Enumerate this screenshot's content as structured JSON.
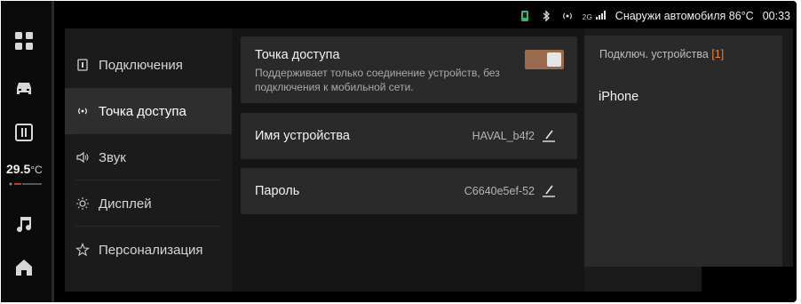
{
  "status_bar": {
    "network_label": "2G",
    "outside_temp_label": "Снаружи автомобиля 86°C",
    "time": "00:33",
    "icons": [
      "phone-connected-icon",
      "bluetooth-icon",
      "hotspot-icon",
      "signal-icon"
    ]
  },
  "left_rail": {
    "icons": [
      "apps-grid-icon",
      "car-icon",
      "settings-panel-icon",
      "music-note-icon",
      "home-icon"
    ],
    "temperature": "29.5",
    "temperature_unit": "°C"
  },
  "menu": {
    "items": [
      {
        "label": "Подключения",
        "icon": "connections-icon",
        "active": false
      },
      {
        "label": "Точка доступа",
        "icon": "hotspot-icon",
        "active": true
      },
      {
        "label": "Звук",
        "icon": "speaker-icon",
        "active": false
      },
      {
        "label": "Дисплей",
        "icon": "brightness-icon",
        "active": false
      },
      {
        "label": "Персонализация",
        "icon": "personalization-icon",
        "active": false
      }
    ]
  },
  "hotspot": {
    "title": "Точка доступа",
    "description": "Поддерживает только соединение устройств, без подключения к мобильной сети.",
    "enabled": true
  },
  "device_name": {
    "label": "Имя устройства",
    "value": "HAVAL_b4f2"
  },
  "password": {
    "label": "Пароль",
    "value": "C6640e5ef-52"
  },
  "connected_devices": {
    "title": "Подключ. устройства",
    "count": "[1]",
    "devices": [
      "iPhone"
    ]
  },
  "colors": {
    "accent": "#e8853a",
    "toggle_on": "#9a6a4c",
    "panel": "#1b1b1b",
    "card": "#2a2a2a"
  }
}
